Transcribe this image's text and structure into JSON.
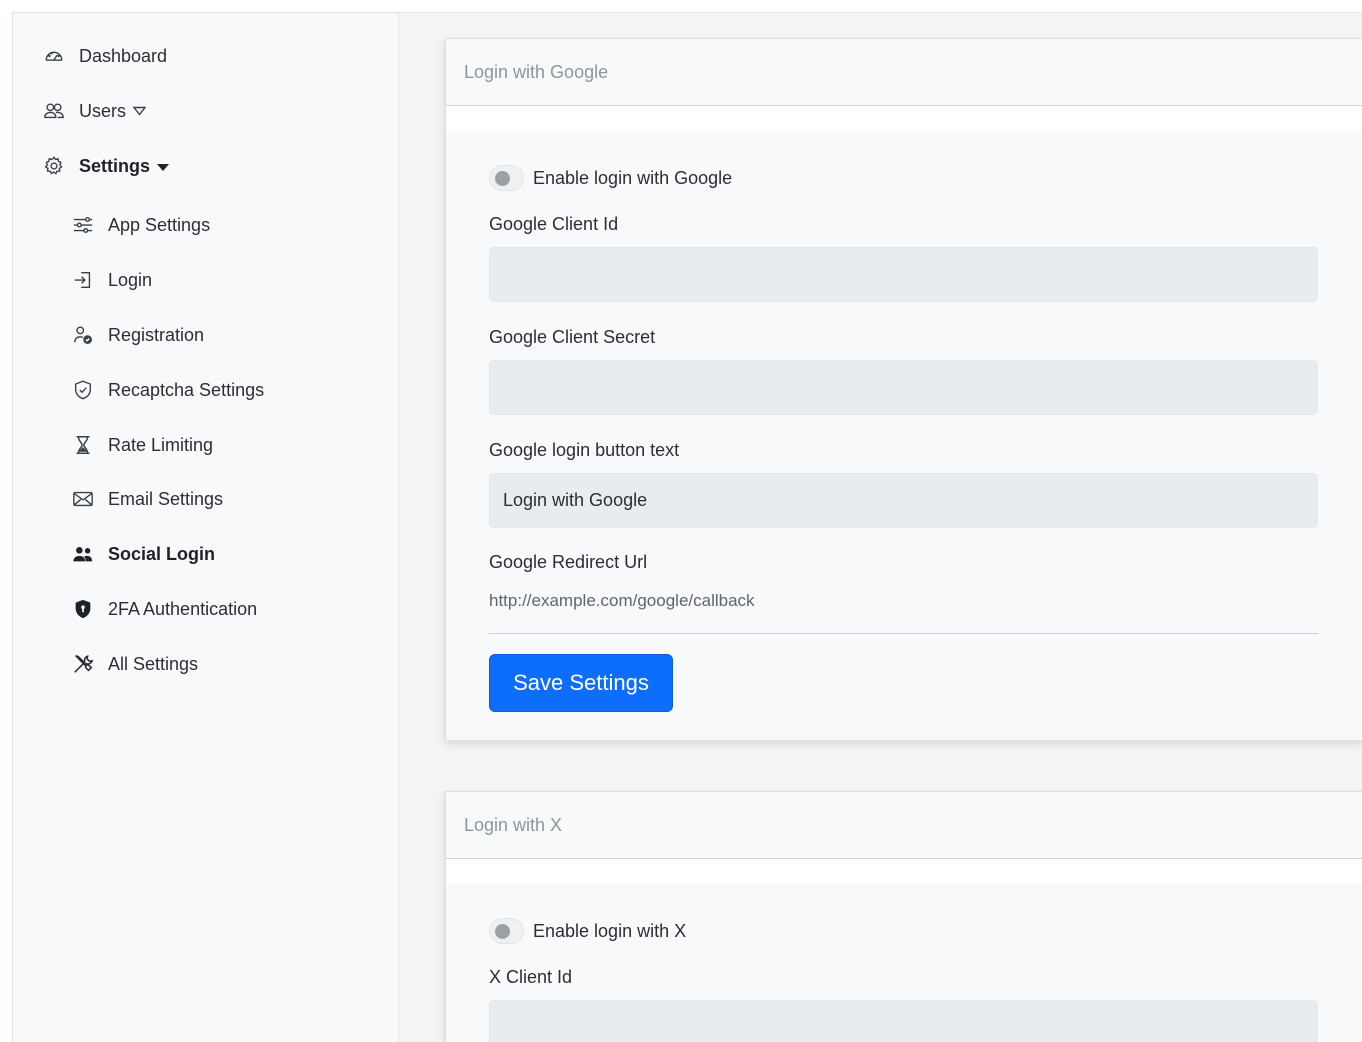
{
  "sidebar": {
    "dashboard": "Dashboard",
    "users": "Users",
    "settings": "Settings",
    "app_settings": "App Settings",
    "login": "Login",
    "registration": "Registration",
    "recaptcha": "Recaptcha Settings",
    "rate_limiting": "Rate Limiting",
    "email_settings": "Email Settings",
    "social_login": "Social Login",
    "twofa": "2FA Authentication",
    "all_settings": "All Settings"
  },
  "google_card": {
    "header": "Login with Google",
    "enable_label": "Enable login with Google",
    "client_id_label": "Google Client Id",
    "client_id_value": "",
    "client_secret_label": "Google Client Secret",
    "client_secret_value": "",
    "button_text_label": "Google login button text",
    "button_text_value": "Login with Google",
    "redirect_label": "Google Redirect Url",
    "redirect_value": "http://example.com/google/callback",
    "save_label": "Save Settings"
  },
  "x_card": {
    "header": "Login with X",
    "enable_label": "Enable login with X",
    "client_id_label": "X Client Id",
    "client_id_value": ""
  },
  "icons": {
    "dashboard": "gauge-icon",
    "users": "users-icon",
    "settings": "gear-icon",
    "app_settings": "sliders-icon",
    "login": "sign-in-icon",
    "registration": "user-check-icon",
    "recaptcha": "shield-check-icon",
    "rate_limiting": "hourglass-icon",
    "email_settings": "envelope-icon",
    "social_login": "people-fill-icon",
    "twofa": "shield-lock-icon",
    "all_settings": "tools-icon"
  },
  "colors": {
    "primary": "#0d6efd",
    "sidebar_bg": "#f8f9fa",
    "input_bg": "#e9ecef"
  }
}
